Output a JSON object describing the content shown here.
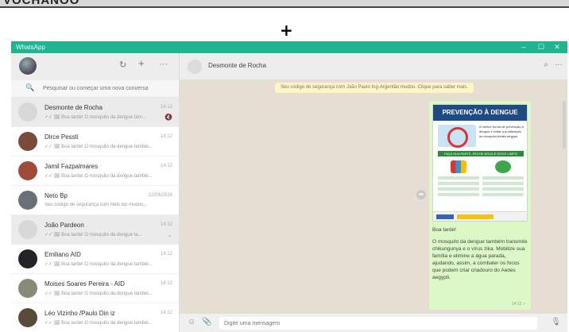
{
  "slide_top_text": "VOCHANOO",
  "plus_sign": "+",
  "window": {
    "title": "WhatsApp",
    "minimize": "–",
    "maximize": "☐",
    "close": "✕"
  },
  "left_header": {
    "refresh_icon": "↻",
    "new_chat_icon": "+",
    "menu_icon": "···"
  },
  "search": {
    "icon": "🔍",
    "placeholder": "Pesquisar ou começar uma nova conversa"
  },
  "chats": [
    {
      "name": "Desmonte de Rocha",
      "time": "14:12",
      "preview": "✓✓ 🖼 Boa tarde! O mosquito da dengue tam...",
      "badge": "🔇",
      "active": true,
      "avatar": "#d8d8d8"
    },
    {
      "name": "Dirce Pessti",
      "time": "14:12",
      "preview": "✓✓ 🖼 Boa tarde! O mosquito da dengue tambéi...",
      "badge": "",
      "active": false,
      "avatar": "#7a4a3a"
    },
    {
      "name": "Jamil Fazpalmares",
      "time": "14:12",
      "preview": "✓✓ 🖼 Boa tarde! O mosquito da dengue tambéi...",
      "badge": "",
      "active": false,
      "avatar": "#a04a3c"
    },
    {
      "name": "Neto Bp",
      "time": "12/04/2016",
      "preview": "Seu código de segurança com Neto Bp mudou...",
      "badge": "",
      "active": false,
      "avatar": "#6b6f77"
    },
    {
      "name": "João Pardeon",
      "time": "14:12",
      "preview": "✓✓ 🖼 Boa tarde! O mosquito da dengue ta...",
      "badge": "⌄",
      "active": true,
      "avatar": "#d8d8d8"
    },
    {
      "name": "Emiliano AID",
      "time": "14:12",
      "preview": "✓✓ 🖼 Boa tarde! O mosquito da dengue tambéi...",
      "badge": "",
      "active": false,
      "avatar": "#222428"
    },
    {
      "name": "Moises Soares Pereira - AID",
      "time": "14:12",
      "preview": "✓✓ 🖼 Boa tarde! O mosquito da dengue tambéi...",
      "badge": "",
      "active": false,
      "avatar": "#8a8a7a"
    },
    {
      "name": "Léo Vizinho /Paulo Din iz",
      "time": "14:12",
      "preview": "✓✓ 🖼 Boa tarde! O mosquito da dengue tambéi...",
      "badge": "",
      "active": false,
      "avatar": "#5a4a3a"
    }
  ],
  "conversation": {
    "name": "Desmonte de Rocha",
    "search_icon": "⌕",
    "menu_icon": "···",
    "system_notice": "Seu código de segurança com João Paulo Ing-Argentão mudou. Clique para saber mais.",
    "forward_icon": "➦",
    "poster": {
      "title": "PREVENÇÃO À DENGUE",
      "intro": "A melhor forma de prevenção à dengue é evitar a proliferação do mosquito Aedes aegypti.",
      "banner": "FAÇA SUA PARTE, FECHE ÁGUA E DEIXE LIMPO"
    },
    "message_lines": [
      "Boa tarde!",
      "O mosquito da dengue também transmite chikungunya e o vírus zika. Mobilize sua família e elimine a água parada, ajudando, assim, a combater os focos que podem criar criadouro do Aedes aegypti."
    ],
    "message_time": "14:12 ✓"
  },
  "composer": {
    "emoji_icon": "☺",
    "attach_icon": "📎",
    "placeholder": "Digite uma mensagem",
    "mic_icon": "🎙"
  }
}
